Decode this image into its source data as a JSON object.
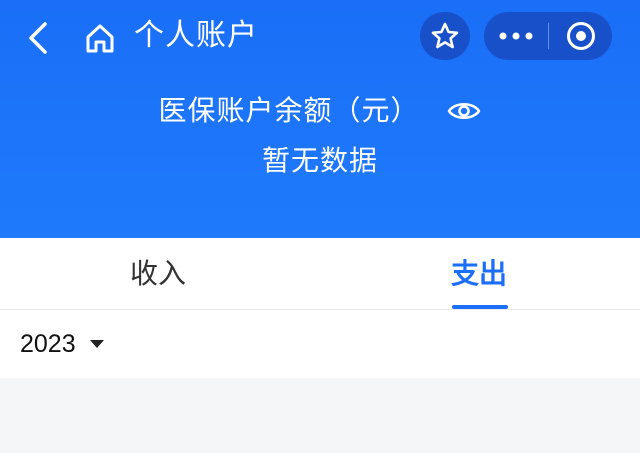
{
  "nav": {
    "title": "个人账户",
    "back_icon": "chevron-left-icon",
    "home_icon": "home-icon",
    "star_icon": "star-icon",
    "more_icon": "more-icon",
    "close_icon": "target-circle-icon"
  },
  "balance": {
    "label": "医保账户余额（元）",
    "value": "暂无数据",
    "eye_icon": "eye-icon"
  },
  "tabs": [
    {
      "label": "收入",
      "active": false
    },
    {
      "label": "支出",
      "active": true
    }
  ],
  "year_filter": {
    "value": "2023",
    "caret_icon": "caret-down-icon"
  },
  "colors": {
    "header_blue": "#1a6ef7",
    "capsule_blue": "#1750c9",
    "active_tab": "#1a6ef7",
    "page_bg": "#f5f6f8"
  }
}
